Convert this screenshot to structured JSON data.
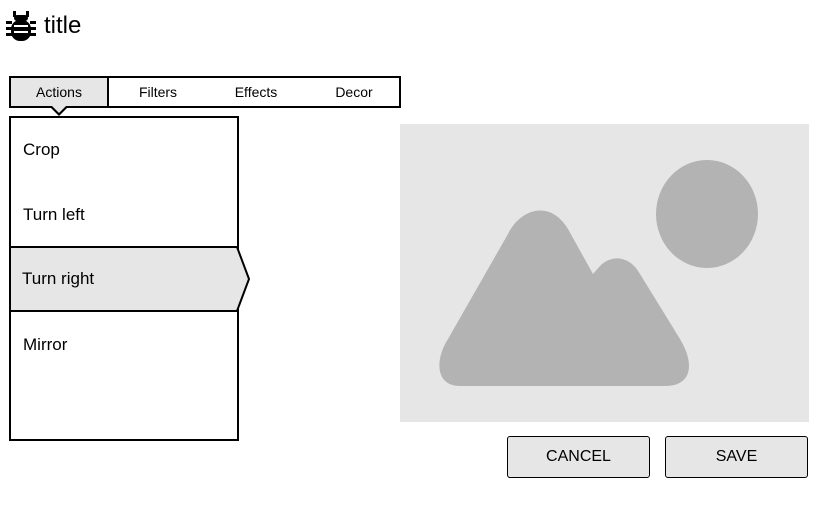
{
  "header": {
    "icon": "bug-icon",
    "title": "title"
  },
  "tabs": [
    {
      "label": "Actions",
      "active": true
    },
    {
      "label": "Filters",
      "active": false
    },
    {
      "label": "Effects",
      "active": false
    },
    {
      "label": "Decor",
      "active": false
    }
  ],
  "actions": {
    "items": [
      {
        "label": "Crop",
        "selected": false
      },
      {
        "label": "Turn left",
        "selected": false
      },
      {
        "label": "Turn right",
        "selected": true
      },
      {
        "label": "Mirror",
        "selected": false
      }
    ]
  },
  "preview": {
    "icon": "image-placeholder-icon"
  },
  "buttons": {
    "cancel_label": "CANCEL",
    "save_label": "SAVE"
  },
  "colors": {
    "selected_bg": "#e6e6e6",
    "placeholder_bg": "#e6e6e6",
    "placeholder_shape": "#b3b3b3",
    "border": "#000000"
  }
}
